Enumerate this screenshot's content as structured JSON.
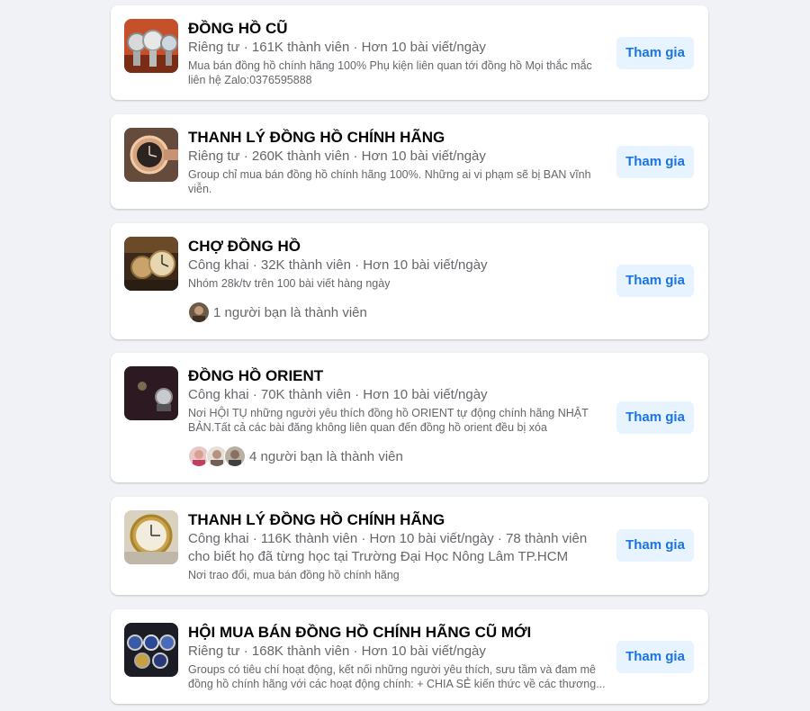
{
  "groups": [
    {
      "name": "ĐỒNG HỒ CŨ",
      "meta": "Riêng tư · 161K thành viên · Hơn 10 bài viết/ngày",
      "desc": "Mua bán đồng hồ chính hãng 100% Phụ kiện liên quan tới đồng hồ Mọi thắc mắc liên hệ Zalo:0376595888",
      "friends": "",
      "join": "Tham gia"
    },
    {
      "name": "THANH LÝ ĐỒNG HỒ CHÍNH HÃNG",
      "meta": "Riêng tư · 260K thành viên · Hơn 10 bài viết/ngày",
      "desc": "Group chỉ mua bán đồng hồ chính hãng 100%. Những ai vi phạm sẽ bị BAN vĩnh viễn.",
      "friends": "",
      "join": "Tham gia"
    },
    {
      "name": "CHỢ ĐỒNG HỒ",
      "meta": "Công khai · 32K thành viên · Hơn 10 bài viết/ngày",
      "desc": "Nhóm 28k/tv trên 100 bài viết hàng ngày",
      "friends": "1 người bạn là thành viên",
      "join": "Tham gia"
    },
    {
      "name": "ĐỒNG HỒ ORIENT",
      "meta": "Công khai · 70K thành viên · Hơn 10 bài viết/ngày",
      "desc": "Nơi HỘI TỤ những người yêu thích đồng hồ ORIENT tự động chính hãng NHẬT BẢN.Tất cả các bài đăng không liên quan đến đồng hồ orient đều bị xóa",
      "friends": "4 người bạn là thành viên",
      "join": "Tham gia"
    },
    {
      "name": "THANH LÝ ĐỒNG HỒ CHÍNH HÃNG",
      "meta": "Công khai · 116K thành viên · Hơn 10 bài viết/ngày · 78 thành viên cho biết họ đã từng học tại Trường Đại Học Nông Lâm TP.HCM",
      "desc": "Nơi trao đổi, mua bán đồng hồ chính hãng",
      "friends": "",
      "join": "Tham gia"
    },
    {
      "name": "HỘI MUA BÁN ĐỒNG HỒ CHÍNH HÃNG CŨ MỚI",
      "meta": "Riêng tư · 168K thành viên · Hơn 10 bài viết/ngày",
      "desc": "Groups có tiêu chí hoạt động, kết nối những người yêu thích, sưu tầm và đam mê đồng hồ chính hãng với các hoạt động chính: + CHIA SẺ kiến thức về các thương...",
      "friends": "",
      "join": "Tham gia"
    }
  ],
  "colors": {
    "background": "#f0f2f5",
    "card": "#ffffff",
    "title": "#050505",
    "secondary": "#65676b",
    "button_bg": "#e7f3ff",
    "button_text": "#1b74e4"
  }
}
